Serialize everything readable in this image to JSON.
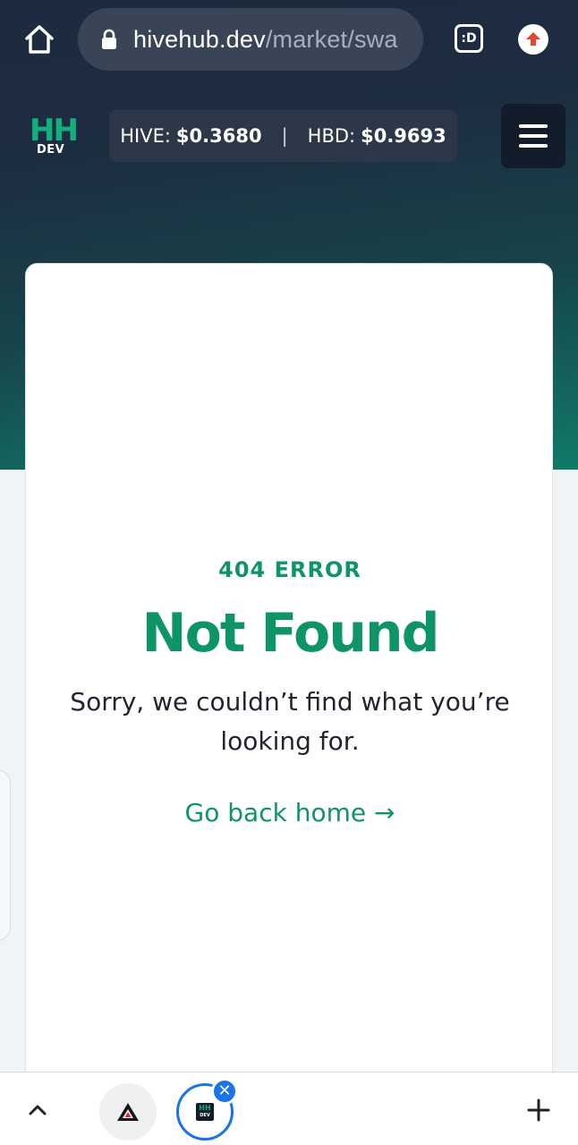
{
  "browser": {
    "url_domain": "hivehub.dev",
    "url_path": "/market/swa",
    "tab_switcher_label": ":D"
  },
  "header": {
    "logo_top": "HH",
    "logo_bottom": "DEV",
    "prices": [
      {
        "label": "HIVE:",
        "value": "$0.3680"
      },
      {
        "label": "HBD:",
        "value": "$0.9693"
      }
    ],
    "separator": "|"
  },
  "error": {
    "code": "404 ERROR",
    "title": "Not Found",
    "message": "Sorry, we couldn’t find what you’re looking for.",
    "link_label": "Go back home →"
  },
  "tabbar": {
    "close_glyph": "✕",
    "tab_logo_top": "HH",
    "tab_logo_bottom": "DEV"
  },
  "colors": {
    "accent": "#0f9467",
    "brand_green": "#12b07e",
    "header_dark": "#1d2a3f",
    "chrome_blue": "#1a73e8"
  }
}
